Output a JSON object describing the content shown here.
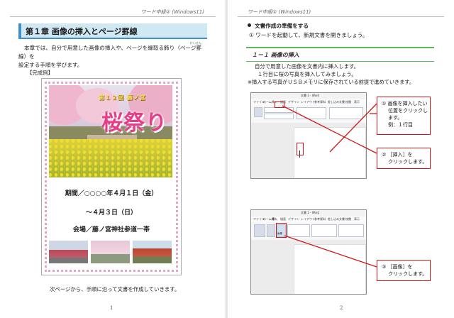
{
  "left_page": {
    "header": "ワード中級② (Windows11)",
    "chapter_title": "第１章 画像の挿入とページ罫線",
    "ruby": "けいせん",
    "intro_line1": "本章では、自分で用意した画像の挿入や、ページを縁取る飾り（ページ罫線）を",
    "intro_line2": "設定する手順を学びます。",
    "example_label": "【完成例】",
    "poster": {
      "small_title": "第１２回 藤ノ宮",
      "main_title": "桜祭り",
      "period_line1": "期間／○○○○年４月１日（金）",
      "period_line2": "～４月３日（日）",
      "venue": "会場／藤ノ宮神社参道一帯"
    },
    "outro": "次ページから、手順に沿って文書を作成していきます。",
    "page_number": "1"
  },
  "right_page": {
    "header": "ワード中級② (Windows11)",
    "section_heading": "文書作成の準備をする",
    "step1": "① ワードを起動して、新規文書を開きましょう。",
    "sub_heading": "１－１ 画像の挿入",
    "body_line1": "自分で用意した画像を文書内に挿入します。",
    "body_line2": "１行目に桜の写真を挿入してみましょう。",
    "note": "※挿入する写真がＵＳＢメモリに保存されている前提で進めていきます。",
    "screenshot1": {
      "title": "文書 1 - Word",
      "tabs": [
        "ファイル",
        "ホーム",
        "挿入",
        "描画",
        "デザイン",
        "レイアウト",
        "参考資料",
        "差し込み文書",
        "校閲",
        "表示",
        "ヘルプ"
      ]
    },
    "screenshot2": {
      "title": "文書 1 - Word",
      "tabs": [
        "ファイル",
        "ホーム",
        "挿入",
        "描画",
        "デザイン",
        "レイアウト",
        "参考資料",
        "差し込み文書",
        "校閲",
        "表示",
        "ヘルプ"
      ],
      "image_button": "画像"
    },
    "callout1": {
      "line1": "① 画像を挿入したい",
      "line2": "位置をクリックし",
      "line3": "ます。",
      "line4": "例：１行目"
    },
    "callout2": {
      "line1": "② ［挿入］を",
      "line2": "クリックします。"
    },
    "callout3": {
      "line1": "③ ［画像］を",
      "line2": "クリックします。"
    },
    "page_number": "2"
  },
  "colors": {
    "chapter_bg": "#cfe8f3",
    "chapter_accent": "#3f90c7",
    "subheading_rule": "#5cb85c",
    "callout_red": "#d01818",
    "poster_pink": "#e63d88"
  }
}
